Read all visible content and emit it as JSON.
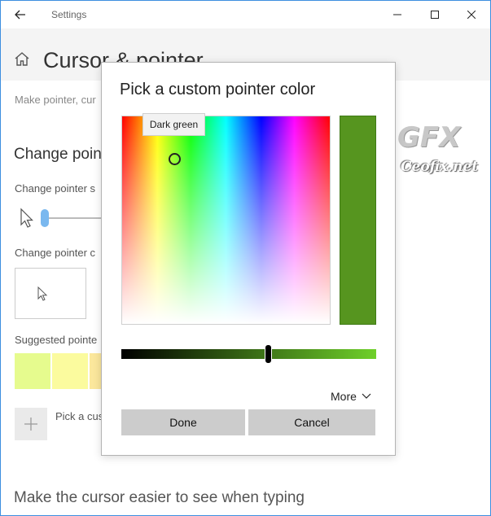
{
  "window": {
    "title": "Settings",
    "back_icon": "back-arrow-icon",
    "minimize_icon": "minimize-icon",
    "maximize_icon": "maximize-icon",
    "close_icon": "close-icon"
  },
  "header": {
    "home_icon": "home-icon",
    "title": "Cursor & pointer"
  },
  "content": {
    "description": "Make pointer, cur",
    "section_title": "Change poin",
    "pointer_size_label": "Change pointer s",
    "pointer_color_label": "Change pointer c",
    "suggested_label": "Suggested pointe",
    "pick_custom_label": "Pick a cus",
    "bottom_title": "Make the cursor easier to see when typing",
    "swatches": [
      "#e6fb8e",
      "#fbfb9e",
      "#fbe79c"
    ],
    "slider_accent": "#7ab8ef"
  },
  "dialog": {
    "title": "Pick a custom pointer color",
    "tooltip": "Dark green",
    "selected_color": "#56951f",
    "more_label": "More",
    "done_label": "Done",
    "cancel_label": "Cancel"
  },
  "watermark": {
    "logo": "GFX",
    "text": "Ceofix.net"
  }
}
